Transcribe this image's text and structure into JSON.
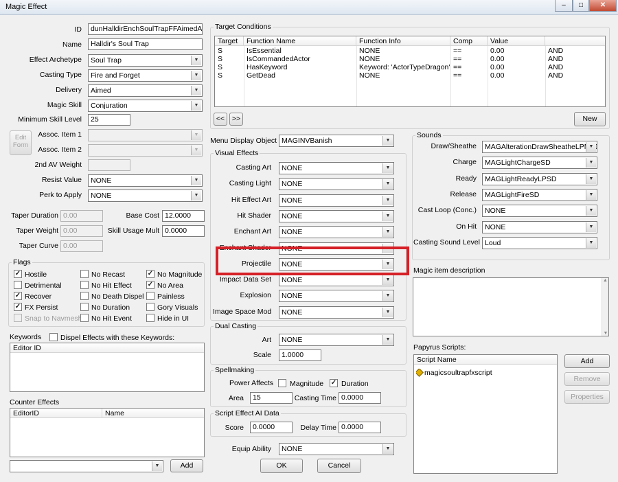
{
  "window": {
    "title": "Magic Effect",
    "minimize": "–",
    "maximize": "□",
    "close": "✕"
  },
  "form": {
    "id_label": "ID",
    "id_value": "dunHalldirEnchSoulTrapFFAimedArea",
    "name_label": "Name",
    "name_value": "Halldir's Soul Trap",
    "archetype_label": "Effect Archetype",
    "archetype_value": "Soul Trap",
    "casting_type_label": "Casting Type",
    "casting_type_value": "Fire and Forget",
    "delivery_label": "Delivery",
    "delivery_value": "Aimed",
    "magic_skill_label": "Magic Skill",
    "magic_skill_value": "Conjuration",
    "min_skill_label": "Minimum Skill Level",
    "min_skill_value": "25",
    "edit_form_label": "Edit Form",
    "assoc1_label": "Assoc. Item 1",
    "assoc1_value": "",
    "assoc2_label": "Assoc. Item 2",
    "assoc2_value": "",
    "av2_label": "2nd AV Weight",
    "av2_value": "",
    "resist_label": "Resist Value",
    "resist_value": "NONE",
    "perk_label": "Perk to Apply",
    "perk_value": "NONE",
    "taper_duration_label": "Taper Duration",
    "taper_duration_value": "0.00",
    "taper_weight_label": "Taper Weight",
    "taper_weight_value": "0.00",
    "taper_curve_label": "Taper Curve",
    "taper_curve_value": "0.00",
    "base_cost_label": "Base Cost",
    "base_cost_value": "12.0000",
    "skill_usage_label": "Skill Usage Mult",
    "skill_usage_value": "0.0000"
  },
  "flags": {
    "title": "Flags",
    "items": [
      {
        "label": "Hostile",
        "checked": "✓",
        "disabled": false
      },
      {
        "label": "Detrimental",
        "checked": "",
        "disabled": false
      },
      {
        "label": "Recover",
        "checked": "✓",
        "disabled": false
      },
      {
        "label": "FX Persist",
        "checked": "✓",
        "disabled": false
      },
      {
        "label": "Snap to Navmesh",
        "checked": "",
        "disabled": true
      },
      {
        "label": "No Recast",
        "checked": "",
        "disabled": false
      },
      {
        "label": "No Hit Effect",
        "checked": "",
        "disabled": false
      },
      {
        "label": "No Death Dispel",
        "checked": "",
        "disabled": false
      },
      {
        "label": "No Duration",
        "checked": "",
        "disabled": false
      },
      {
        "label": "No Hit Event",
        "checked": "",
        "disabled": false
      },
      {
        "label": "No Magnitude",
        "checked": "✓",
        "disabled": false
      },
      {
        "label": "No Area",
        "checked": "✓",
        "disabled": false
      },
      {
        "label": "Painless",
        "checked": "",
        "disabled": false
      },
      {
        "label": "Gory Visuals",
        "checked": "",
        "disabled": false
      },
      {
        "label": "Hide in UI",
        "checked": "",
        "disabled": false
      }
    ]
  },
  "keywords": {
    "title": "Keywords",
    "dispel_label": "Dispel Effects with these Keywords:",
    "dispel_checked": "",
    "column": "Editor ID"
  },
  "counter_effects": {
    "title": "Counter Effects",
    "col1": "EditorID",
    "col2": "Name",
    "add_label": "Add",
    "dropdown_value": ""
  },
  "target_conditions": {
    "title": "Target Conditions",
    "columns": [
      "Target",
      "Function Name",
      "Function Info",
      "Comp",
      "Value",
      ""
    ],
    "rows": [
      [
        "S",
        "IsEssential",
        "NONE",
        "==",
        "0.00",
        "AND"
      ],
      [
        "S",
        "IsCommandedActor",
        "NONE",
        "==",
        "0.00",
        "AND"
      ],
      [
        "S",
        "HasKeyword",
        "Keyword: 'ActorTypeDragon'",
        "==",
        "0.00",
        "AND"
      ],
      [
        "S",
        "GetDead",
        "NONE",
        "==",
        "0.00",
        "AND"
      ]
    ],
    "prev_label": "<<",
    "next_label": ">>",
    "new_label": "New"
  },
  "menu_display": {
    "label": "Menu Display Object",
    "value": "MAGINVBanish"
  },
  "visual_effects": {
    "title": "Visual Effects",
    "items": [
      {
        "label": "Casting Art",
        "value": "NONE"
      },
      {
        "label": "Casting Light",
        "value": "NONE"
      },
      {
        "label": "Hit Effect Art",
        "value": "NONE"
      },
      {
        "label": "Hit Shader",
        "value": "NONE"
      },
      {
        "label": "Enchant Art",
        "value": "NONE"
      },
      {
        "label": "Enchant Shader",
        "value": "NONE"
      },
      {
        "label": "Projectile",
        "value": "NONE"
      },
      {
        "label": "Impact Data Set",
        "value": "NONE"
      },
      {
        "label": "Explosion",
        "value": "NONE"
      },
      {
        "label": "Image Space Mod",
        "value": "NONE"
      }
    ]
  },
  "dual_casting": {
    "title": "Dual Casting",
    "art_label": "Art",
    "art_value": "NONE",
    "scale_label": "Scale",
    "scale_value": "1.0000"
  },
  "spellmaking": {
    "title": "Spellmaking",
    "power_affects_label": "Power Affects",
    "magnitude_label": "Magnitude",
    "magnitude_checked": "",
    "duration_label": "Duration",
    "duration_checked": "✓",
    "area_label": "Area",
    "area_value": "15",
    "casting_time_label": "Casting Time",
    "casting_time_value": "0.0000"
  },
  "script_ai": {
    "title": "Script Effect AI Data",
    "score_label": "Score",
    "score_value": "0.0000",
    "delay_label": "Delay Time",
    "delay_value": "0.0000"
  },
  "equip_ability": {
    "label": "Equip Ability",
    "value": "NONE"
  },
  "buttons": {
    "ok": "OK",
    "cancel": "Cancel"
  },
  "sounds": {
    "title": "Sounds",
    "items": [
      {
        "label": "Draw/Sheathe",
        "value": "MAGAlterationDrawSheatheLPMSD"
      },
      {
        "label": "Charge",
        "value": "MAGLightChargeSD"
      },
      {
        "label": "Ready",
        "value": "MAGLightReadyLPSD"
      },
      {
        "label": "Release",
        "value": "MAGLightFireSD"
      },
      {
        "label": "Cast Loop (Conc.)",
        "value": "NONE"
      },
      {
        "label": "On Hit",
        "value": "NONE"
      },
      {
        "label": "Casting Sound Level",
        "value": "Loud"
      }
    ]
  },
  "magic_item_description": {
    "label": "Magic item description",
    "value": ""
  },
  "papyrus": {
    "title": "Papyrus Scripts:",
    "column": "Script Name",
    "scripts": [
      "magicsoultrapfxscript"
    ],
    "add_label": "Add",
    "remove_label": "Remove",
    "properties_label": "Properties"
  },
  "colors": {
    "highlight_box": "#d62027",
    "window_bg": "#f0f0f0"
  }
}
